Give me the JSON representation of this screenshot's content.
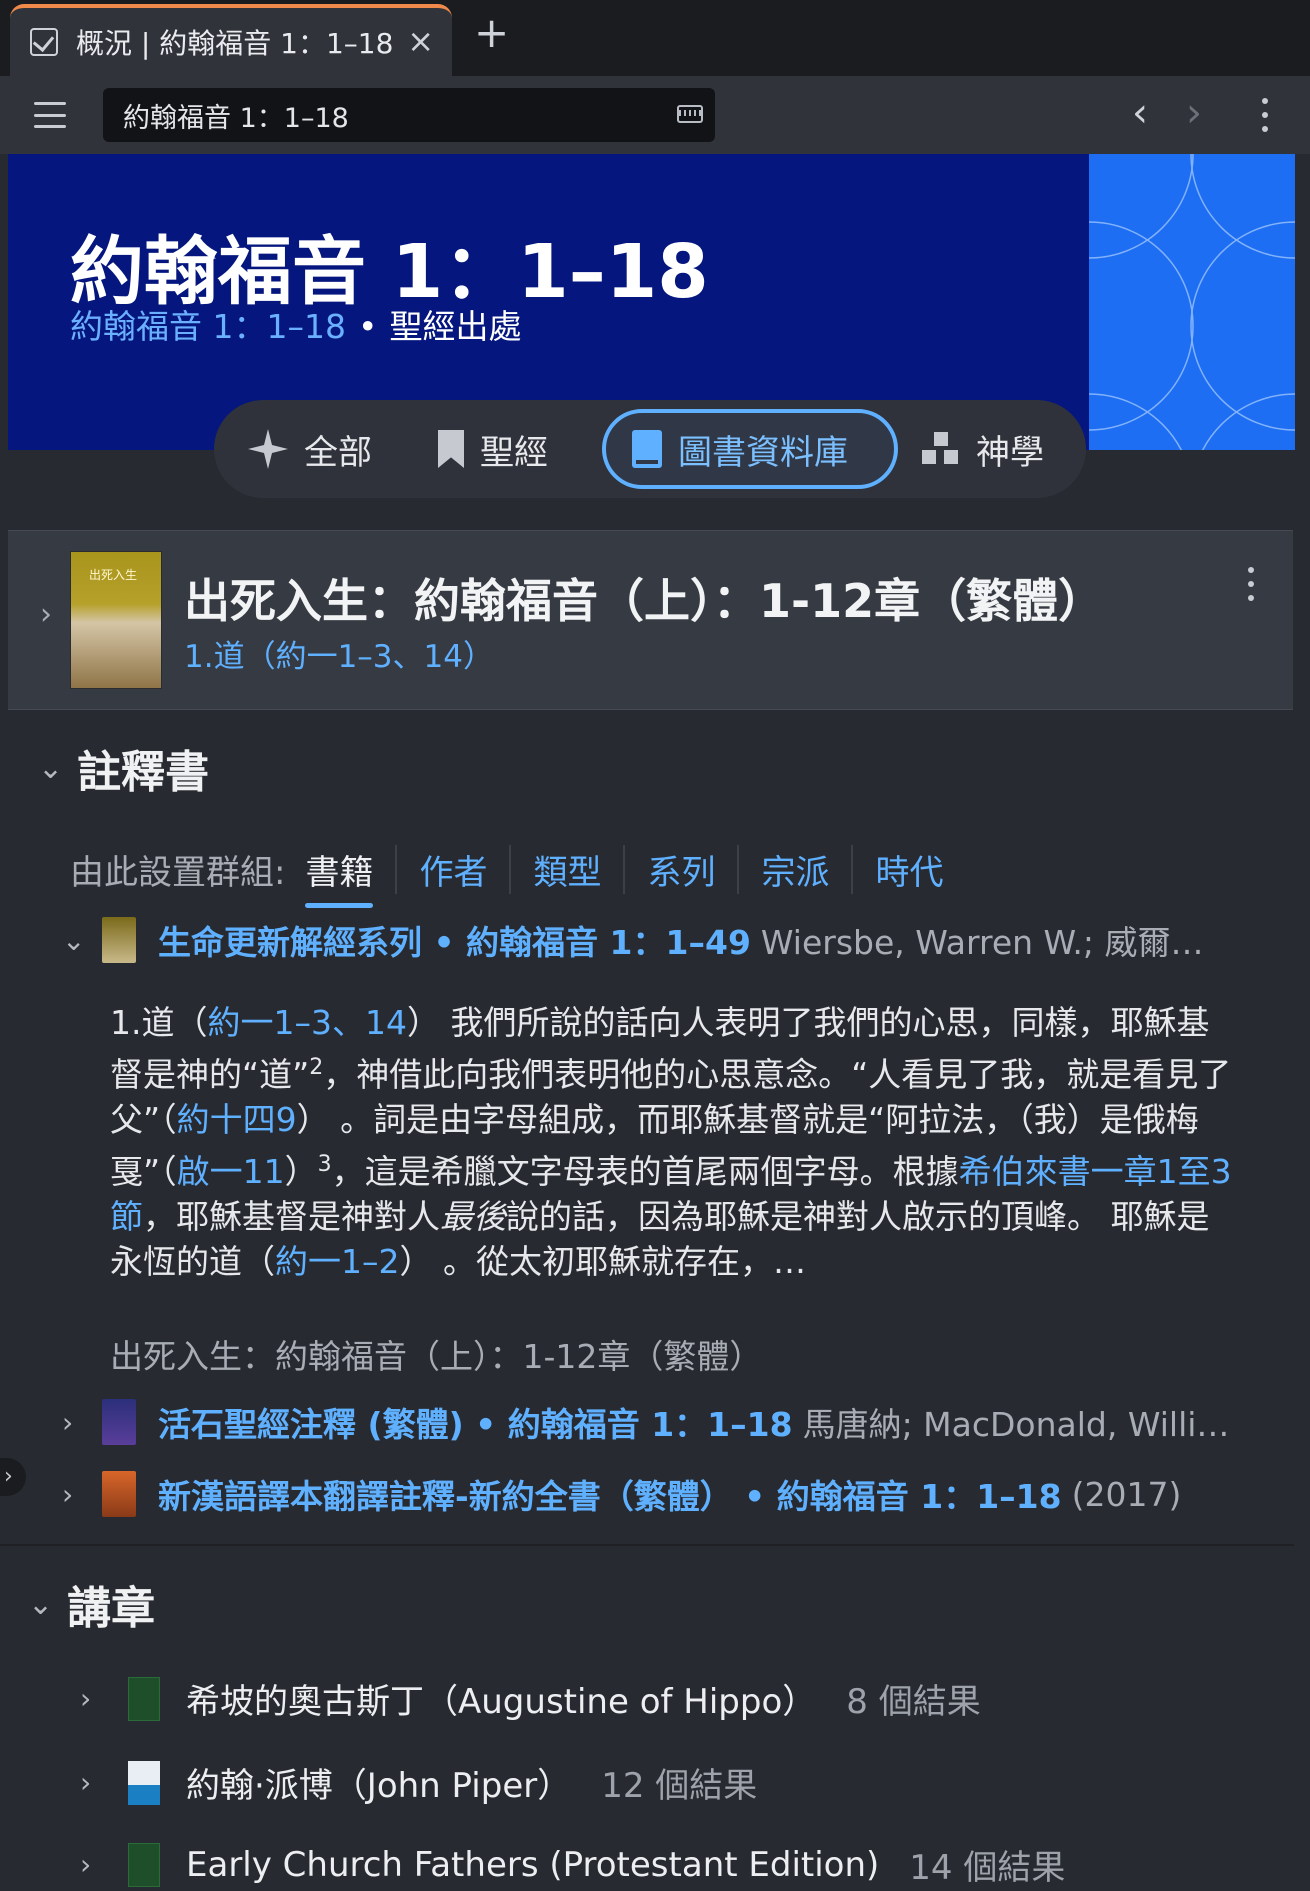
{
  "tab": {
    "title": "概況 | 約翰福音 1：1–18",
    "close": "×",
    "new_tab": "+"
  },
  "toolbar": {
    "search_value": "約翰福音 1：1–18",
    "back": "‹",
    "forward": "›"
  },
  "hero": {
    "title": "約翰福音 1：1–18",
    "subtitle_ref": "約翰福音 1：1–18",
    "subtitle_sep": "•",
    "subtitle_kind": "聖經出處",
    "colors": {
      "banner": "#05177e",
      "art": "#1d6ef2"
    }
  },
  "filters": [
    {
      "label": "全部",
      "icon": "sparkle-icon"
    },
    {
      "label": "聖經",
      "icon": "bookmark-icon"
    },
    {
      "label": "圖書資料庫",
      "icon": "book-icon",
      "selected": true
    },
    {
      "label": "神學",
      "icon": "blocks-icon"
    }
  ],
  "top_card": {
    "title": "出死入生：約翰福音（上）：1-12章（繁體）",
    "subtitle": "1.道（約一1–3、14）",
    "cover_text": "出死入生"
  },
  "commentaries": {
    "heading": "註釋書",
    "group_by_label": "由此設置群組:",
    "group_by": [
      "書籍",
      "作者",
      "類型",
      "系列",
      "宗派",
      "時代"
    ],
    "results": [
      {
        "title": "生命更新解經系列 • 約翰福音 1：1–49",
        "meta": "Wiersbe, Warren W.; 威爾…",
        "expanded": true
      },
      {
        "title": "活石聖經注釋 (繁體) • 約翰福音 1：1–18",
        "meta": "馬唐納; MacDonald, Willi…",
        "expanded": false
      },
      {
        "title": "新漢語譯本翻譯註釋-新約全書（繁體） • 約翰福音 1：1–18",
        "meta": "(2017)",
        "expanded": false
      }
    ],
    "excerpt": {
      "t1": "1.道（",
      "l1": "約一1–3、14",
      "t2": "） 我們所說的話向人表明了我們的心思，同樣，耶穌基督是神的“道”",
      "sup1": "2",
      "t3": "，神借此向我們表明他的心思意念。“人看見了我，就是看見了父”（",
      "l2": "約十四9",
      "t4": "） 。詞是由字母組成，而耶穌基督就是“阿拉法，（我）是俄梅戛”（",
      "l3": "啟一11",
      "t5": "）",
      "sup2": "3",
      "t6": "，這是希臘文字母表的首尾兩個字母。根據",
      "l4": "希伯來書一章1至3節",
      "t7": "，耶穌基督是神對人",
      "em1": "最後",
      "t8": "說的話，因為耶穌是神對人啟示的頂峰。 耶穌是永恆的道（",
      "l5": "約一1–2",
      "t9": "） 。從太初耶穌就存在，…",
      "source": "出死入生：約翰福音（上）：1-12章（繁體）"
    }
  },
  "sermons": {
    "heading": "講章",
    "items": [
      {
        "name": "希坡的奧古斯丁（Augustine of Hippo）",
        "count": "8 個結果"
      },
      {
        "name": "約翰·派博（John Piper）",
        "count": "12 個結果"
      },
      {
        "name": "Early Church Fathers (Protestant Edition)",
        "count": "14 個結果"
      }
    ]
  }
}
